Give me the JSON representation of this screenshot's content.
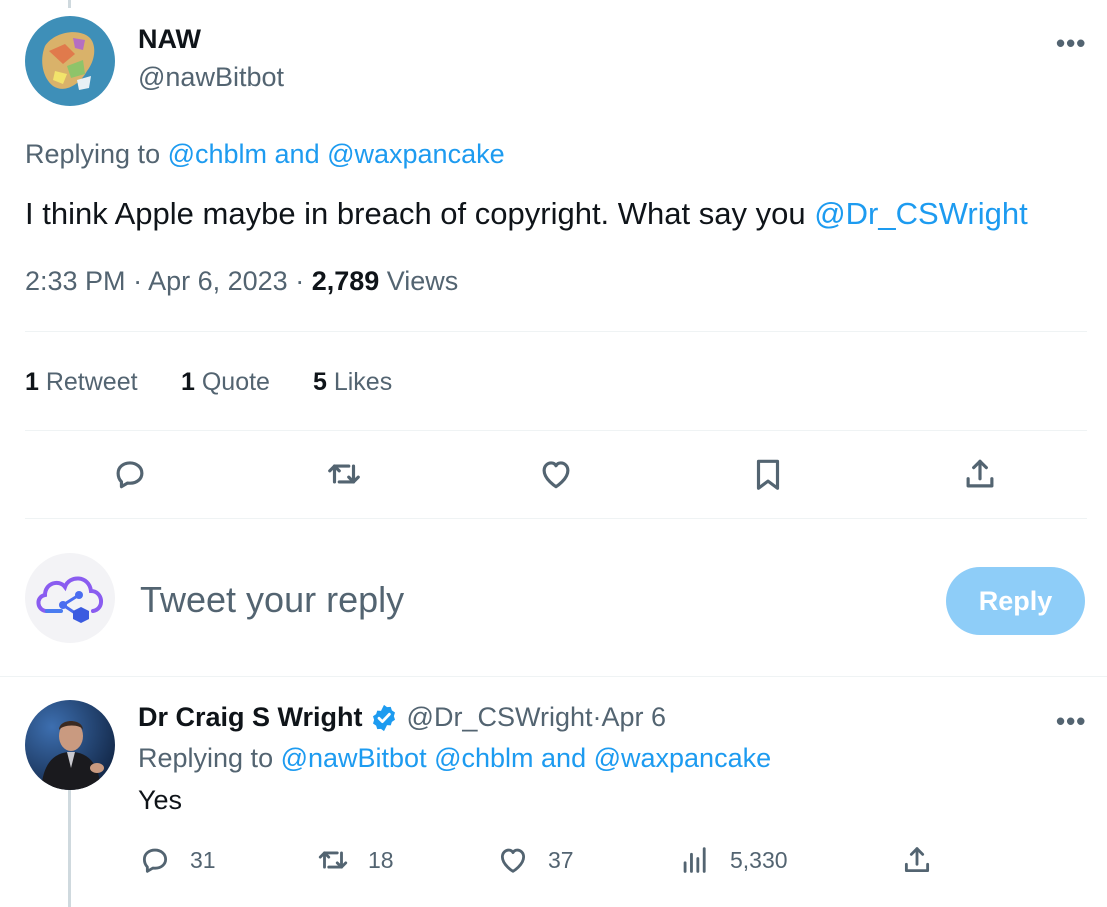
{
  "main_tweet": {
    "author_name": "NAW",
    "author_handle": "@nawBitbot",
    "more_label": "•••",
    "replying_prefix": "Replying to ",
    "replying_user1": "@chblm",
    "replying_and": " and ",
    "replying_user2": "@waxpancake",
    "text": "I think Apple maybe in breach of copyright. What say you ",
    "mention": "@Dr_CSWright",
    "time": "2:33 PM",
    "sep": " · ",
    "date": "Apr 6, 2023",
    "views_count": "2,789",
    "views_label": " Views"
  },
  "stats": {
    "retweets_count": "1",
    "retweets_label": " Retweet",
    "quotes_count": "1",
    "quotes_label": " Quote",
    "likes_count": "5",
    "likes_label": " Likes"
  },
  "actions": [
    "reply-icon",
    "retweet-icon",
    "like-icon",
    "bookmark-icon",
    "share-icon"
  ],
  "composer": {
    "placeholder": "Tweet your reply",
    "button_label": "Reply"
  },
  "reply_tweet": {
    "author_name": "Dr Craig S Wright",
    "verified": true,
    "author_handle": "@Dr_CSWright",
    "sep": " · ",
    "date": "Apr 6",
    "more_label": "•••",
    "replying_prefix": "Replying to ",
    "replying_user1": "@nawBitbot",
    "replying_user2": "@chblm",
    "replying_and": " and ",
    "replying_user3": "@waxpancake",
    "text": "Yes",
    "replies": "31",
    "retweets": "18",
    "likes": "37",
    "views": "5,330"
  },
  "colors": {
    "accent": "#1d9bf0",
    "muted": "#536471",
    "reply_button": "#8ecdf8",
    "divider": "#eff3f4"
  }
}
